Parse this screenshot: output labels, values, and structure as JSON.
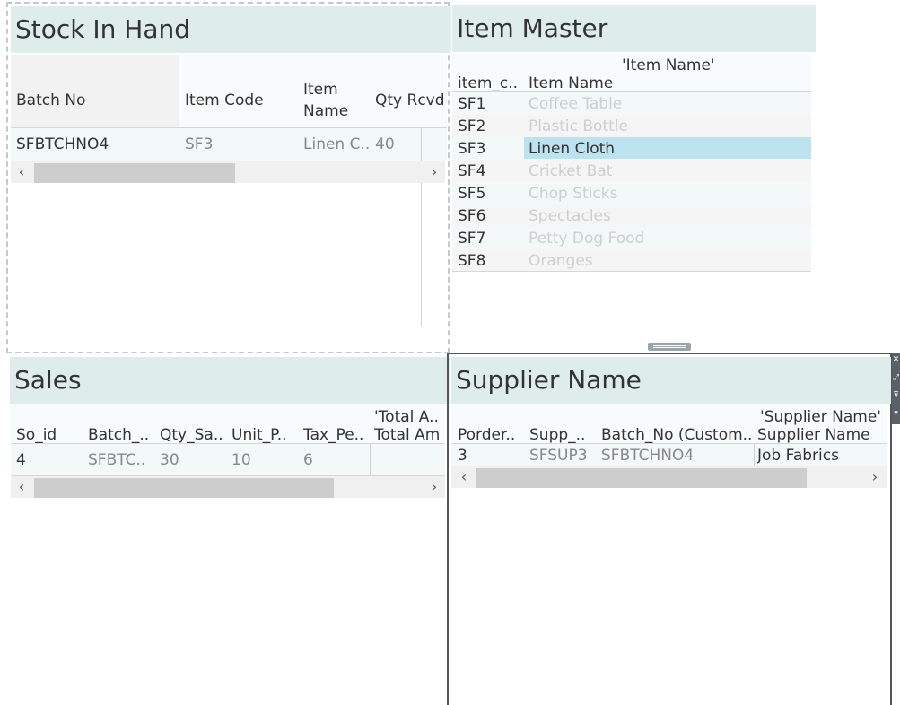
{
  "stock": {
    "title": "Stock In Hand",
    "headers": [
      "Batch No",
      "Item Code",
      "Item",
      "Name",
      "Qty Rcvd"
    ],
    "row": [
      "SFBTCHNO4",
      "SF3",
      "Linen C..",
      "40"
    ]
  },
  "item_master": {
    "title": "Item Master",
    "header_top": "'Item Name'",
    "headers": [
      "item_c..",
      "Item Name"
    ],
    "rows": [
      {
        "code": "SF1",
        "name": "Coffee Table"
      },
      {
        "code": "SF2",
        "name": "Plastic Bottle"
      },
      {
        "code": "SF3",
        "name": "Linen Cloth"
      },
      {
        "code": "SF4",
        "name": "Cricket Bat"
      },
      {
        "code": "SF5",
        "name": "Chop Sticks"
      },
      {
        "code": "SF6",
        "name": "Spectacles"
      },
      {
        "code": "SF7",
        "name": "Petty Dog Food"
      },
      {
        "code": "SF8",
        "name": "Oranges"
      }
    ],
    "highlight_color": "#bde3f0"
  },
  "sales": {
    "title": "Sales",
    "header_top": "'Total A..",
    "headers": [
      "So_id",
      "Batch_..",
      "Qty_Sa..",
      "Unit_P..",
      "Tax_Pe..",
      "Total Am"
    ],
    "row": [
      "4",
      "SFBTC..",
      "30",
      "10",
      "6"
    ]
  },
  "supplier": {
    "title": "Supplier Name",
    "header_top": "'Supplier Name'",
    "headers": [
      "Porder..",
      "Supp_..",
      "Batch_No (Custom..",
      "Supplier Name"
    ],
    "row": [
      "3",
      "SFSUP3",
      "SFBTCHNO4",
      "Job Fabrics"
    ]
  },
  "scroll": {
    "left": "‹",
    "right": "›"
  },
  "toolbar": {
    "close": "✕",
    "expand": "⤢",
    "filter": "⊽",
    "more": "▾"
  },
  "colors": {
    "title_bg": "#deedeb",
    "row_bg": "#f3f8f8",
    "highlight": "#bde3f0"
  }
}
